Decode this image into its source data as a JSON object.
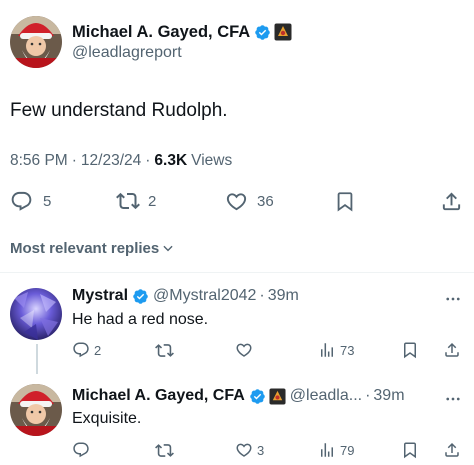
{
  "main_tweet": {
    "author_name": "Michael A. Gayed, CFA",
    "handle": "@leadlagreport",
    "text": "Few understand Rudolph.",
    "time": "8:56 PM",
    "separator": "·",
    "date": "12/23/24",
    "views_count": "6.3K",
    "views_label": "Views",
    "replies": "5",
    "retweets": "2",
    "likes": "36"
  },
  "sort_label": "Most relevant replies",
  "replies": [
    {
      "author_name": "Mystral",
      "handle": "@Mystral2042",
      "separator": "·",
      "time": "39m",
      "text": "He had a red nose.",
      "reply_count": "2",
      "retweet_count": "",
      "like_count": "",
      "view_count": "73"
    },
    {
      "author_name": "Michael A. Gayed, CFA",
      "handle": "@leadla...",
      "separator": "·",
      "time": "39m",
      "text": "Exquisite.",
      "reply_count": "",
      "retweet_count": "",
      "like_count": "3",
      "view_count": "79"
    }
  ],
  "colors": {
    "text": "#0f1419",
    "muted": "#536471",
    "verified": "#1d9bf0",
    "divider": "#eff3f4"
  },
  "icons": [
    "reply-icon",
    "retweet-icon",
    "like-icon",
    "bookmark-icon",
    "share-icon",
    "views-icon",
    "more-icon",
    "verified-badge-icon",
    "chevron-down-icon"
  ]
}
